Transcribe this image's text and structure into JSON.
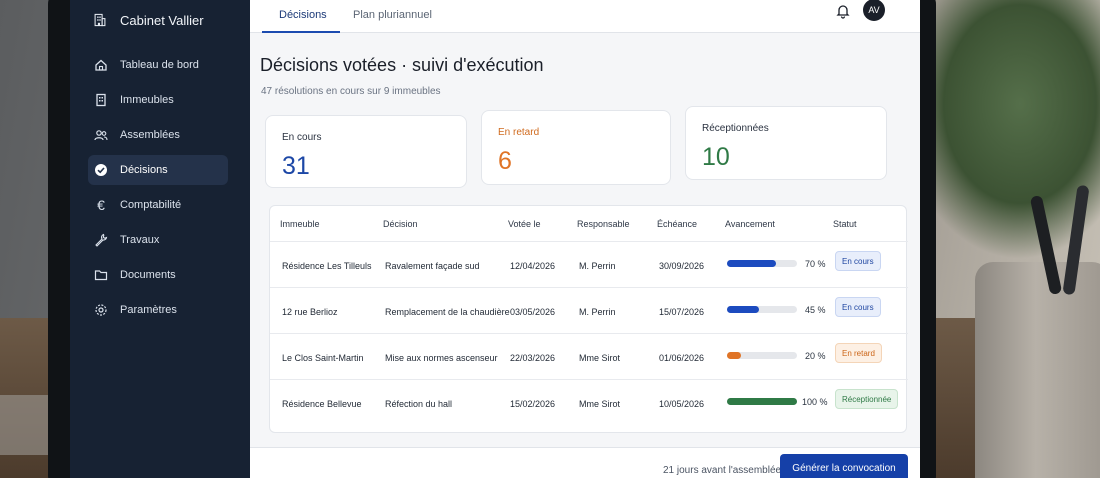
{
  "app": {
    "name": "Cabinet Vallier"
  },
  "sidebar": {
    "items": [
      {
        "label": "Tableau de bord",
        "icon": "home-icon"
      },
      {
        "label": "Immeubles",
        "icon": "building-icon"
      },
      {
        "label": "Assemblées",
        "icon": "users-icon"
      },
      {
        "label": "Décisions",
        "icon": "check-circle-icon",
        "active": true
      },
      {
        "label": "Comptabilité",
        "icon": "euro-icon"
      },
      {
        "label": "Travaux",
        "icon": "wrench-icon"
      },
      {
        "label": "Documents",
        "icon": "folder-icon"
      },
      {
        "label": "Paramètres",
        "icon": "gear-icon"
      }
    ]
  },
  "header": {
    "tabs": [
      {
        "label": "Décisions",
        "active": true
      },
      {
        "label": "Plan pluriannuel"
      }
    ],
    "avatar_initials": "AV"
  },
  "page": {
    "title": "Décisions votées · suivi d'exécution",
    "subtitle": "47 résolutions en cours sur 9 immeubles"
  },
  "stats": [
    {
      "label": "En cours",
      "value": "31",
      "label_color": "#1f2733",
      "value_color": "#1c47a6"
    },
    {
      "label": "En retard",
      "value": "6",
      "label_color": "#d06b1f",
      "value_color": "#e07426"
    },
    {
      "label": "Réceptionnées",
      "value": "10",
      "label_color": "#1f2733",
      "value_color": "#2f7a46"
    }
  ],
  "table": {
    "headers": [
      "Immeuble",
      "Décision",
      "Votée le",
      "Responsable",
      "Échéance",
      "Avancement",
      "Statut"
    ],
    "rows": [
      {
        "immeuble": "Résidence Les Tilleuls",
        "decision": "Ravalement façade sud",
        "votee": "12/04/2026",
        "responsable": "M. Perrin",
        "echeance": "30/09/2026",
        "progress": 70,
        "progress_label": "70 %",
        "statut": "En cours",
        "bar_color": "#1c4bbf",
        "badge_bg": "#e8eefb",
        "badge_fg": "#1f46a1",
        "badge_border": "#c9d6f2"
      },
      {
        "immeuble": "12 rue Berlioz",
        "decision": "Remplacement de la chaudière",
        "votee": "03/05/2026",
        "responsable": "M. Perrin",
        "echeance": "15/07/2026",
        "progress": 45,
        "progress_label": "45 %",
        "statut": "En cours",
        "bar_color": "#1c4bbf",
        "badge_bg": "#e8eefb",
        "badge_fg": "#1f46a1",
        "badge_border": "#c9d6f2"
      },
      {
        "immeuble": "Le Clos Saint-Martin",
        "decision": "Mise aux normes ascenseur",
        "votee": "22/03/2026",
        "responsable": "Mme Sirot",
        "echeance": "01/06/2026",
        "progress": 20,
        "progress_label": "20 %",
        "statut": "En retard",
        "bar_color": "#e07426",
        "badge_bg": "#fdf0e4",
        "badge_fg": "#cc6518",
        "badge_border": "#f4d5b8"
      },
      {
        "immeuble": "Résidence Bellevue",
        "decision": "Réfection du hall",
        "votee": "15/02/2026",
        "responsable": "Mme Sirot",
        "echeance": "10/05/2026",
        "progress": 100,
        "progress_label": "100 %",
        "statut": "Réceptionnée",
        "bar_color": "#2f7a46",
        "badge_bg": "#e8f4ea",
        "badge_fg": "#2f7a46",
        "badge_border": "#c8e3cd"
      }
    ]
  },
  "footer": {
    "note": "21 jours avant l'assemblée",
    "cta": "Générer la convocation"
  }
}
